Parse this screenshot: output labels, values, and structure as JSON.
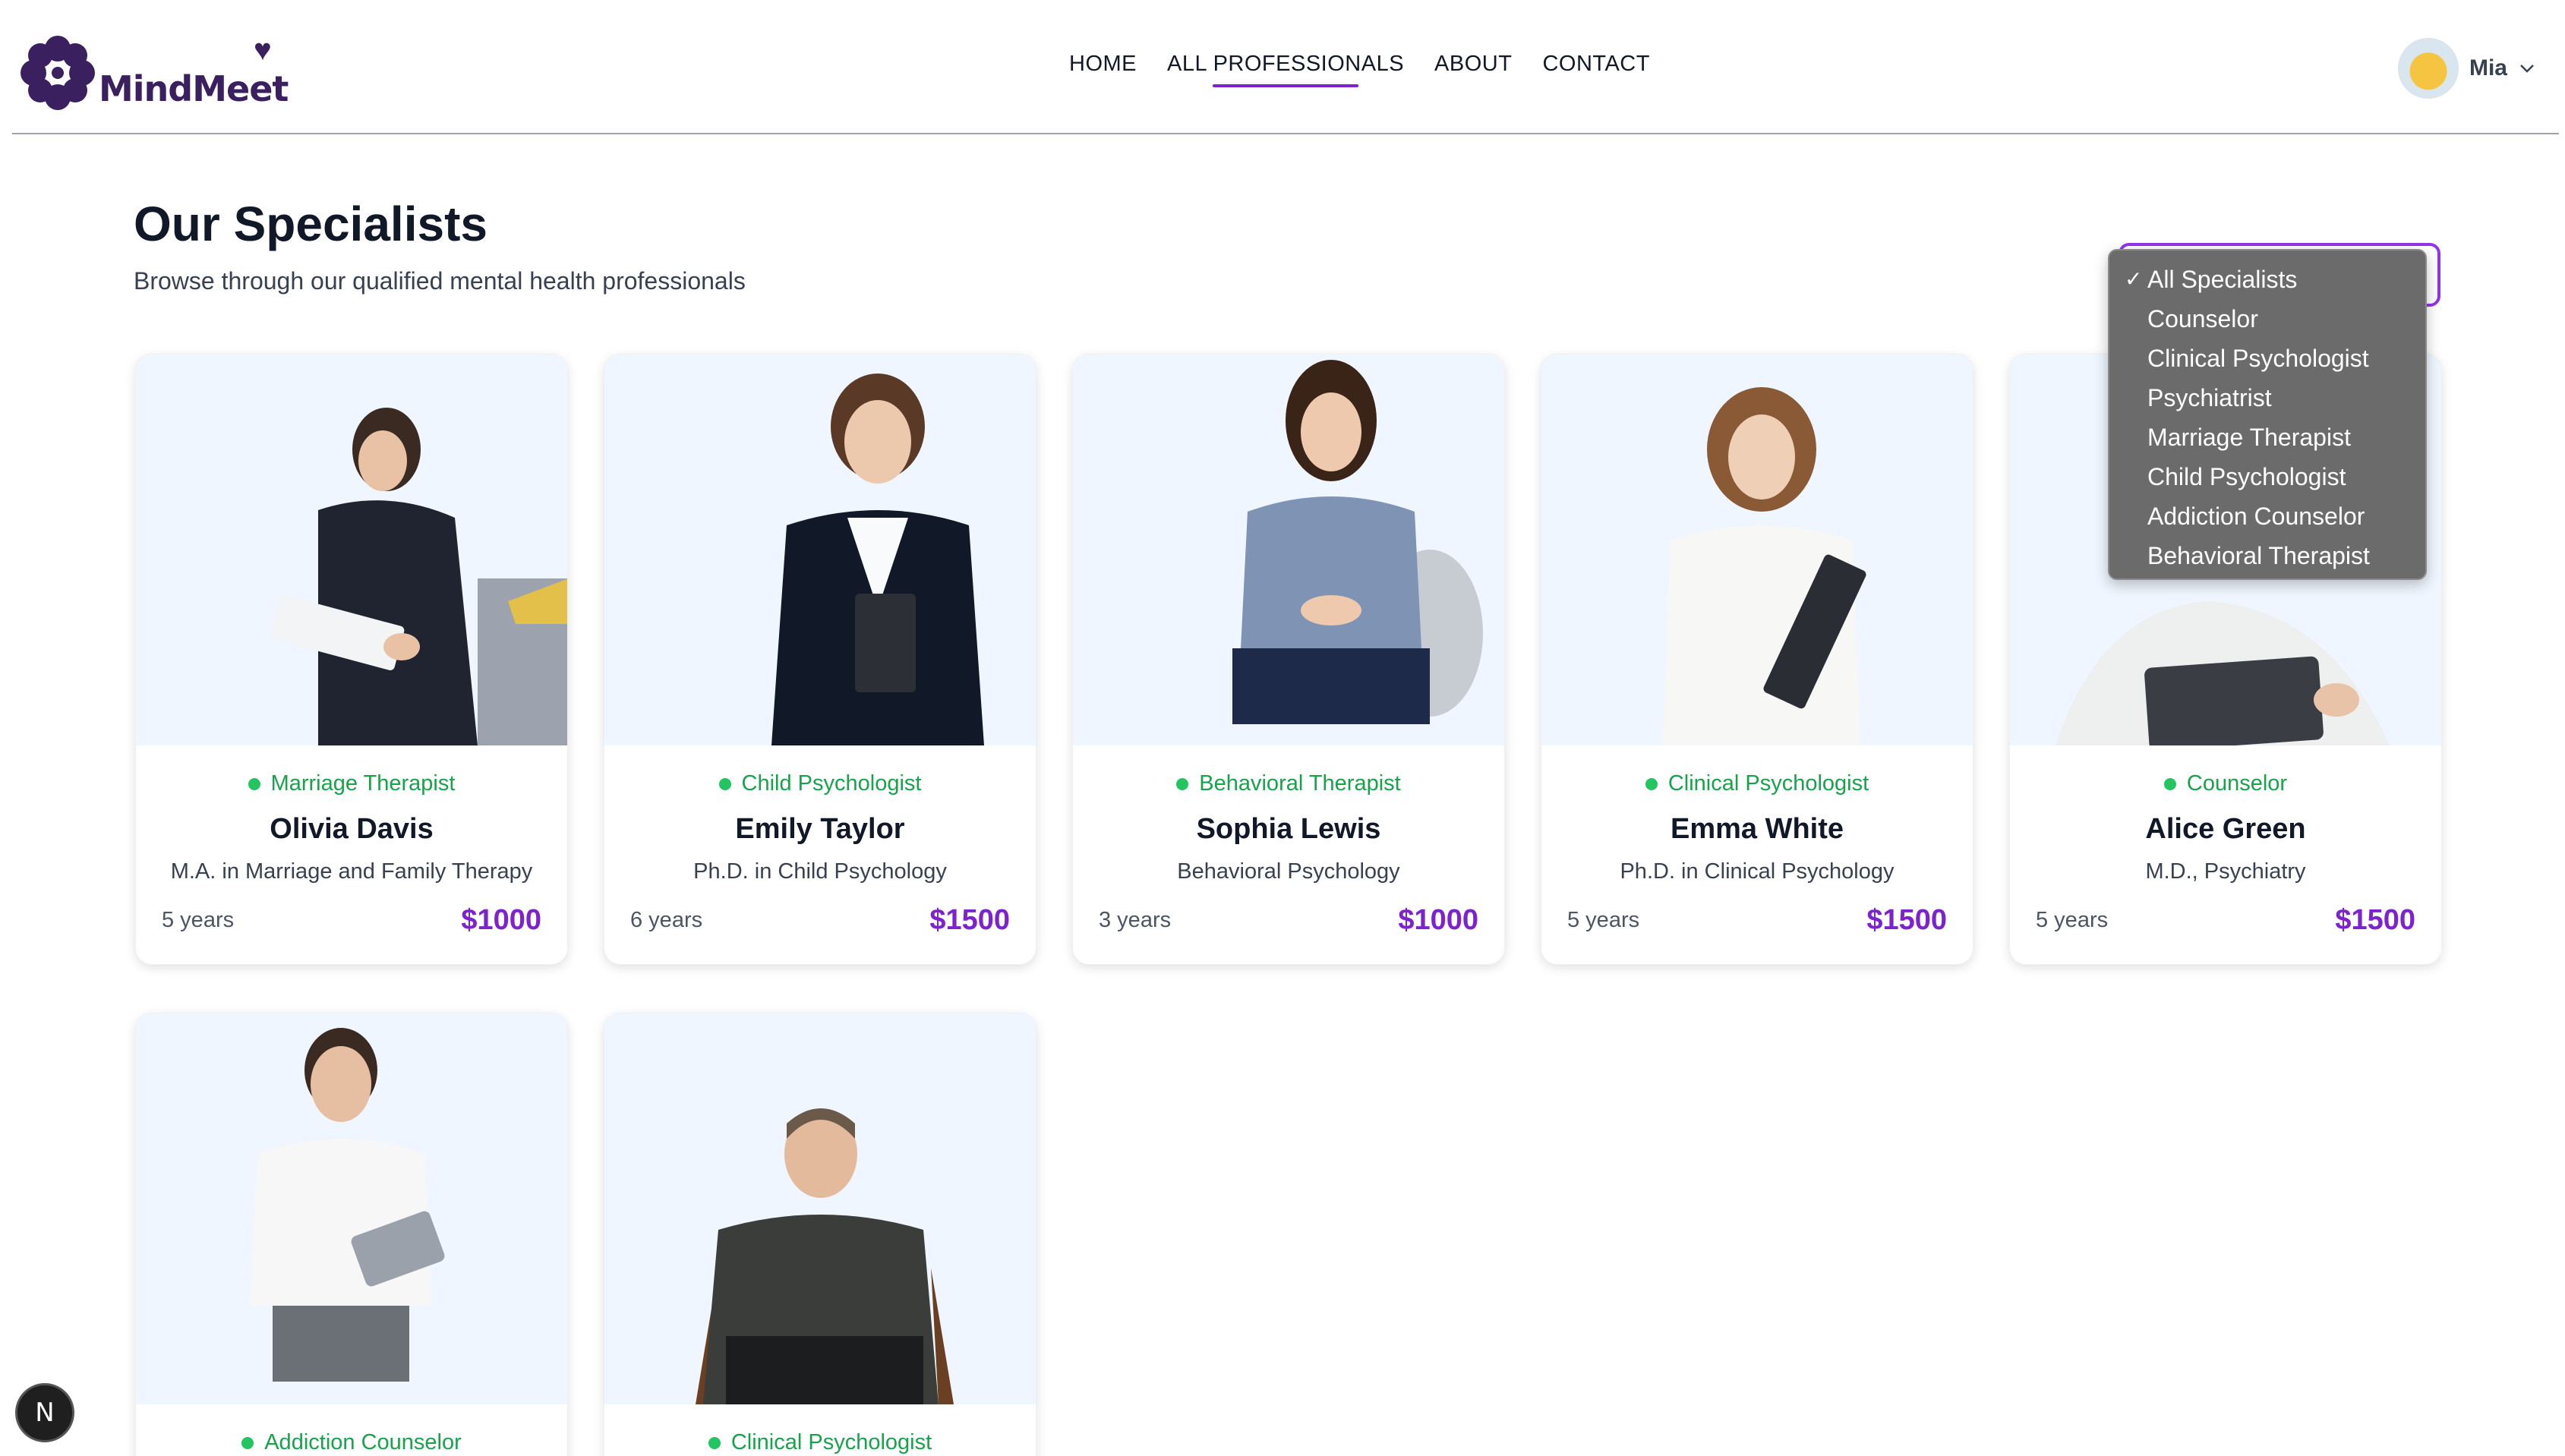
{
  "brand": {
    "name": "MindMeet"
  },
  "nav": [
    {
      "label": "HOME",
      "active": false
    },
    {
      "label": "ALL PROFESSIONALS",
      "active": true
    },
    {
      "label": "ABOUT",
      "active": false
    },
    {
      "label": "CONTACT",
      "active": false
    }
  ],
  "user": {
    "name": "Mia"
  },
  "page": {
    "title": "Our Specialists",
    "subtitle": "Browse through our qualified mental health professionals"
  },
  "filter": {
    "selected": "All Specialists",
    "options": [
      "All Specialists",
      "Counselor",
      "Clinical Psychologist",
      "Psychiatrist",
      "Marriage Therapist",
      "Child Psychologist",
      "Addiction Counselor",
      "Behavioral Therapist"
    ]
  },
  "cards": [
    {
      "specialty": "Marriage Therapist",
      "name": "Olivia Davis",
      "degree": "M.A. in Marriage and Family Therapy",
      "experience": "5 years",
      "fee": "$1000"
    },
    {
      "specialty": "Child Psychologist",
      "name": "Emily Taylor",
      "degree": "Ph.D. in Child Psychology",
      "experience": "6 years",
      "fee": "$1500"
    },
    {
      "specialty": "Behavioral Therapist",
      "name": "Sophia Lewis",
      "degree": "Behavioral Psychology",
      "experience": "3 years",
      "fee": "$1000"
    },
    {
      "specialty": "Clinical Psychologist",
      "name": "Emma White",
      "degree": "Ph.D. in Clinical Psychology",
      "experience": "5 years",
      "fee": "$1500"
    },
    {
      "specialty": "Counselor",
      "name": "Alice Green",
      "degree": "M.D., Psychiatry",
      "experience": "5 years",
      "fee": "$1500"
    },
    {
      "specialty": "Addiction Counselor"
    },
    {
      "specialty": "Clinical Psychologist"
    }
  ],
  "devtools_badge": "N"
}
